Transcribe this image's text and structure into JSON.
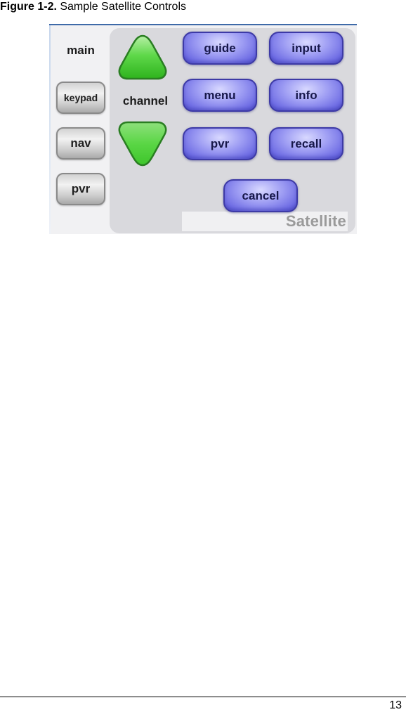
{
  "caption": {
    "label": "Figure 1-2.",
    "text": "Sample Satellite Controls"
  },
  "remote": {
    "active_tab": "main",
    "side_tabs": [
      {
        "label": "keypad"
      },
      {
        "label": "nav"
      },
      {
        "label": "pvr"
      }
    ],
    "channel": {
      "label": "channel",
      "up_icon": "triangle-up-icon",
      "down_icon": "triangle-down-icon"
    },
    "buttons": {
      "guide": "guide",
      "input": "input",
      "menu": "menu",
      "info": "info",
      "pvr": "pvr",
      "recall": "recall",
      "cancel": "cancel"
    },
    "brand": "Satellite",
    "colors": {
      "channel_green": "#3fcf2a",
      "button_blue": "#7b79ea",
      "frame_border": "#3e6aa8"
    }
  },
  "footer": {
    "page_number": "13"
  }
}
